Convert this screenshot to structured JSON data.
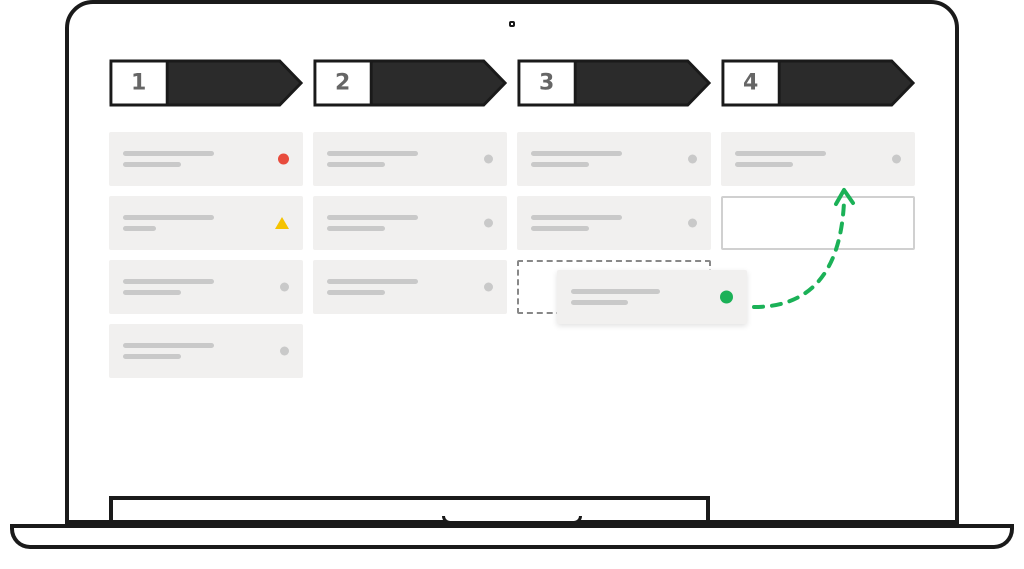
{
  "device": "laptop",
  "board": {
    "columns": [
      {
        "label": "1",
        "cards": [
          {
            "status": "red-dot"
          },
          {
            "status": "yellow-triangle"
          },
          {
            "status": "gray-dot"
          },
          {
            "status": "gray-dot"
          }
        ]
      },
      {
        "label": "2",
        "cards": [
          {
            "status": "gray-dot"
          },
          {
            "status": "gray-dot"
          },
          {
            "status": "gray-dot"
          }
        ]
      },
      {
        "label": "3",
        "cards": [
          {
            "status": "gray-dot"
          },
          {
            "status": "gray-dot"
          },
          {
            "type": "placeholder"
          }
        ]
      },
      {
        "label": "4",
        "cards": [
          {
            "status": "gray-dot"
          },
          {
            "type": "empty-target"
          }
        ]
      }
    ],
    "dragging_card": {
      "status": "green-dot",
      "from_column": "3",
      "to_column": "4"
    }
  },
  "colors": {
    "frame": "#1a1a1a",
    "header_fill": "#2b2b2b",
    "card_bg": "#f1f0ef",
    "line": "#c9c9c9",
    "red": "#e84c3d",
    "yellow": "#f5c300",
    "green": "#1bb157"
  }
}
